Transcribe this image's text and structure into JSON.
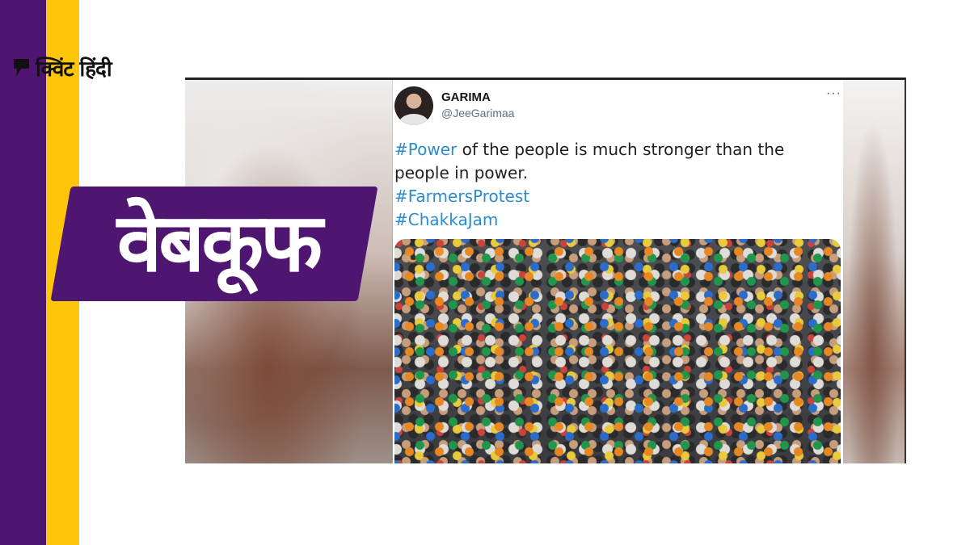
{
  "brand": {
    "name": "क्विंट हिंदी",
    "icon": "quint-q-logo-icon",
    "colors": {
      "purple": "#4e1670",
      "yellow": "#fdc60a"
    }
  },
  "label": {
    "text": "वेबकूफ"
  },
  "tweet": {
    "avatar": "avatar-photo",
    "name": "GARIMA",
    "handle": "@JeeGarimaa",
    "more": "···",
    "line_1_tag": "#Power",
    "line_1_rest": " of the people is much stronger than the people in power.",
    "hashtag_2": "#FarmersProtest",
    "hashtag_3": "#ChakkaJam",
    "hashtag_color": "#2a8ccf",
    "image": "crowd-of-protesters-photo"
  }
}
